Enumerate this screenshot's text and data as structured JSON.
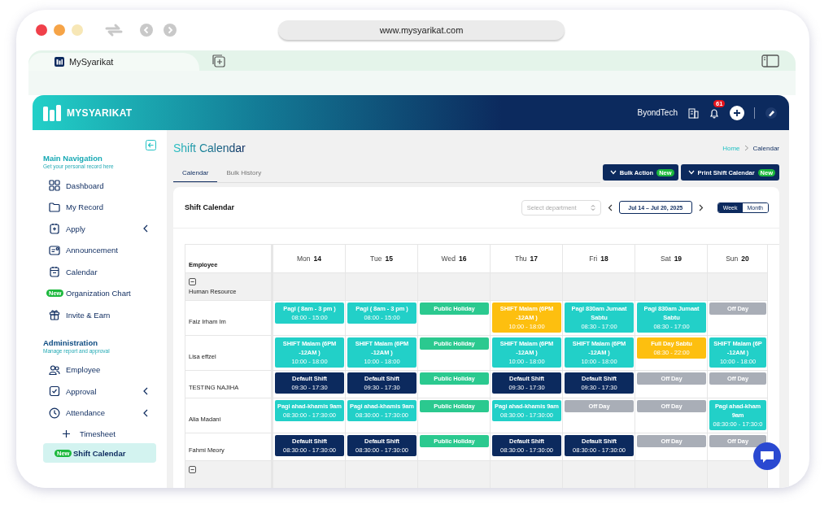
{
  "browser": {
    "address": "www.mysyarikat.com",
    "tab_title": "MySyarikat"
  },
  "app_header": {
    "brand": "MYSYARIKAT",
    "company": "ByondTech",
    "notifications": "61"
  },
  "sidebar": {
    "sections": [
      {
        "title": "Main Navigation",
        "subtitle": "Get your personal record here",
        "items": [
          {
            "label": "Dashboard",
            "expandable": false,
            "selected": false
          },
          {
            "label": "My Record",
            "expandable": false,
            "selected": false
          },
          {
            "label": "Apply",
            "expandable": true,
            "selected": false
          },
          {
            "label": "Announcement",
            "expandable": false,
            "selected": false
          },
          {
            "label": "Calendar",
            "expandable": false,
            "selected": false
          },
          {
            "label": "Organization Chart",
            "badge": "New",
            "expandable": false,
            "selected": false
          },
          {
            "label": "Invite & Earn",
            "expandable": false,
            "selected": false
          }
        ]
      },
      {
        "title": "Administration",
        "subtitle": "Manage report and approval",
        "items": [
          {
            "label": "Employee",
            "expandable": false,
            "selected": false
          },
          {
            "label": "Approval",
            "expandable": true,
            "selected": false
          },
          {
            "label": "Attendance",
            "expandable": true,
            "selected": false,
            "children": [
              {
                "label": "Timesheet",
                "selected": false
              },
              {
                "label": "Shift Calendar",
                "badge": "New",
                "selected": true
              }
            ]
          }
        ]
      }
    ]
  },
  "page": {
    "title": "Shift Calendar",
    "breadcrumb": [
      "Home",
      "Calendar"
    ],
    "tabs": [
      {
        "label": "Calendar",
        "selected": true
      },
      {
        "label": "Bulk History",
        "selected": false
      }
    ],
    "actions": [
      {
        "label": "Bulk Action",
        "badge": "New"
      },
      {
        "label": "Print Shift Calendar",
        "badge": "New"
      }
    ]
  },
  "calendar": {
    "title": "Shift Calendar",
    "department_placeholder": "Select department",
    "date_range": "Jul 14 – Jul 20, 2025",
    "views": [
      {
        "label": "Week",
        "selected": true
      },
      {
        "label": "Month",
        "selected": false
      }
    ],
    "employee_header": "Employee",
    "days": [
      {
        "day": "Mon",
        "date": "14"
      },
      {
        "day": "Tue",
        "date": "15"
      },
      {
        "day": "Wed",
        "date": "16"
      },
      {
        "day": "Thu",
        "date": "17"
      },
      {
        "day": "Fri",
        "date": "18"
      },
      {
        "day": "Sat",
        "date": "19"
      },
      {
        "day": "Sun",
        "date": "20"
      }
    ],
    "groups": [
      {
        "name": "Human Resource",
        "expanded": true,
        "employees": [
          {
            "name": "Faiz Irham Im",
            "shifts": [
              {
                "name": "Pagi ( 8am - 3 pm )",
                "time": "08:00 - 15:00",
                "color": "#22d0c8"
              },
              {
                "name": "Pagi ( 8am - 3 pm )",
                "time": "08:00 - 15:00",
                "color": "#22d0c8"
              },
              {
                "name": "Public Holiday",
                "color": "#2bc98f"
              },
              {
                "name": "SHIFT Malam (6PM -12AM )",
                "time": "10:00 - 18:00",
                "color": "#fdbf0f"
              },
              {
                "name": "Pagi 830am Jumaat Sabtu",
                "time": "08:30 - 17:00",
                "color": "#22d0c8"
              },
              {
                "name": "Pagi 830am Jumaat Sabtu",
                "time": "08:30 - 17:00",
                "color": "#22d0c8"
              },
              {
                "name": "Off Day",
                "color": "#a9aeb7"
              }
            ]
          },
          {
            "name": "Lisa effzel",
            "shifts": [
              {
                "name": "SHIFT Malam (6PM -12AM )",
                "time": "10:00 - 18:00",
                "color": "#22d0c8"
              },
              {
                "name": "SHIFT Malam (6PM -12AM )",
                "time": "10:00 - 18:00",
                "color": "#22d0c8"
              },
              {
                "name": "Public Holiday",
                "color": "#2bc98f"
              },
              {
                "name": "SHIFT Malam (6PM -12AM )",
                "time": "10:00 - 18:00",
                "color": "#22d0c8"
              },
              {
                "name": "SHIFT Malam (6PM -12AM )",
                "time": "10:00 - 18:00",
                "color": "#22d0c8"
              },
              {
                "name": "Full Day Sabtu",
                "time": "08:30 - 22:00",
                "color": "#fdbf0f"
              },
              {
                "name": "SHIFT Malam (6P -12AM )",
                "time": "10:00 - 18:00",
                "color": "#22d0c8"
              }
            ]
          },
          {
            "name": "TESTING NAJIHA",
            "shifts": [
              {
                "name": "Default Shift",
                "time": "09:30 - 17:30",
                "color": "#0c2a5e"
              },
              {
                "name": "Default Shift",
                "time": "09:30 - 17:30",
                "color": "#0c2a5e"
              },
              {
                "name": "Public Holiday",
                "color": "#2bc98f"
              },
              {
                "name": "Default Shift",
                "time": "09:30 - 17:30",
                "color": "#0c2a5e"
              },
              {
                "name": "Default Shift",
                "time": "09:30 - 17:30",
                "color": "#0c2a5e"
              },
              {
                "name": "Off Day",
                "color": "#a9aeb7"
              },
              {
                "name": "Off Day",
                "color": "#a9aeb7"
              }
            ]
          },
          {
            "name": "Alia Madani",
            "shifts": [
              {
                "name": "Pagi ahad-khamis 9am",
                "time": "08:30:00 - 17:30:00",
                "color": "#22d0c8"
              },
              {
                "name": "Pagi ahad-khamis 9am",
                "time": "08:30:00 - 17:30:00",
                "color": "#22d0c8"
              },
              {
                "name": "Public Holiday",
                "color": "#2bc98f"
              },
              {
                "name": "Pagi ahad-khamis 9am",
                "time": "08:30:00 - 17:30:00",
                "color": "#22d0c8"
              },
              {
                "name": "Off Day",
                "color": "#a9aeb7"
              },
              {
                "name": "Off Day",
                "color": "#a9aeb7"
              },
              {
                "name": "Pagi ahad-kham 9am",
                "time": "08:30:00 - 17:30:0",
                "color": "#22d0c8"
              }
            ]
          },
          {
            "name": "Fahmi Meory",
            "shifts": [
              {
                "name": "Default Shift",
                "time": "08:30:00 - 17:30:00",
                "color": "#0c2a5e"
              },
              {
                "name": "Default Shift",
                "time": "08:30:00 - 17:30:00",
                "color": "#0c2a5e"
              },
              {
                "name": "Public Holiday",
                "color": "#2bc98f"
              },
              {
                "name": "Default Shift",
                "time": "08:30:00 - 17:30:00",
                "color": "#0c2a5e"
              },
              {
                "name": "Default Shift",
                "time": "08:30:00 - 17:30:00",
                "color": "#0c2a5e"
              },
              {
                "name": "Off Day",
                "color": "#a9aeb7"
              },
              {
                "name": "Off Day",
                "color": "#a9aeb7"
              }
            ]
          }
        ]
      },
      {
        "expanded": true
      }
    ]
  }
}
